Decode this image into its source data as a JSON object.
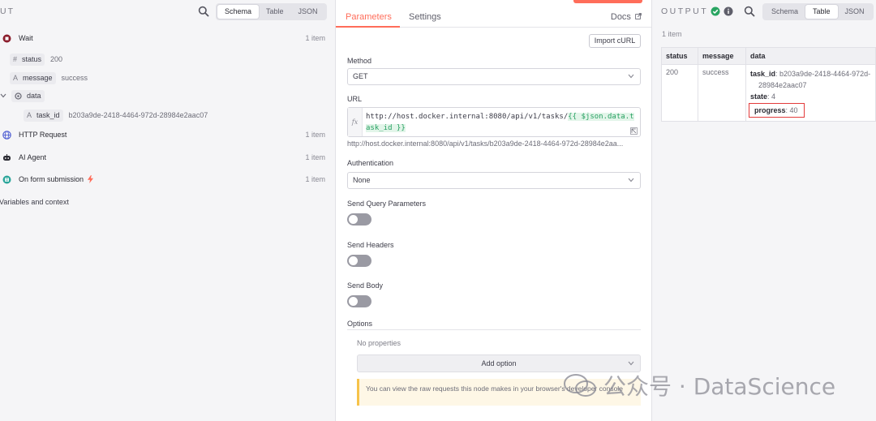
{
  "left_panel": {
    "title": "UT",
    "view_tabs": [
      "Schema",
      "Table",
      "JSON"
    ],
    "active_view": "Schema",
    "nodes": [
      {
        "name": "Wait",
        "count": "1 item",
        "icon": "wait-node-icon"
      },
      {
        "name": "HTTP Request",
        "count": "1 item",
        "icon": "globe-icon"
      },
      {
        "name": "AI Agent",
        "count": "1 item",
        "icon": "robot-icon"
      },
      {
        "name": "On form submission",
        "count": "1 item",
        "icon": "form-trigger-icon"
      }
    ],
    "fields": {
      "status": {
        "type": "#",
        "key": "status",
        "value": "200"
      },
      "message": {
        "type": "A",
        "key": "message",
        "value": "success"
      },
      "data": {
        "key": "data"
      },
      "task_id": {
        "type": "A",
        "key": "task_id",
        "value": "b203a9de-2418-4464-972d-28984e2aac07"
      }
    },
    "variables_label": "Variables and context"
  },
  "middle_panel": {
    "tabs": [
      "Parameters",
      "Settings"
    ],
    "active_tab": "Parameters",
    "docs_label": "Docs",
    "import_curl_label": "Import cURL",
    "method": {
      "label": "Method",
      "value": "GET"
    },
    "url": {
      "label": "URL",
      "expr_prefix": "http://host.docker.internal:8080/api/v1/tasks/",
      "expr_var": "{{ $json.data.task_id }}",
      "preview": "http://host.docker.internal:8080/api/v1/tasks/b203a9de-2418-4464-972d-28984e2aa..."
    },
    "authentication": {
      "label": "Authentication",
      "value": "None"
    },
    "send_query_label": "Send Query Parameters",
    "send_headers_label": "Send Headers",
    "send_body_label": "Send Body",
    "options_label": "Options",
    "no_properties": "No properties",
    "add_option_label": "Add option",
    "notice": "You can view the raw requests this node makes in your browser's developer console"
  },
  "right_panel": {
    "title": "OUTPUT",
    "view_tabs": [
      "Schema",
      "Table",
      "JSON"
    ],
    "active_view": "Table",
    "item_count": "1 item",
    "columns": [
      "status",
      "message",
      "data"
    ],
    "row": {
      "status": "200",
      "message": "success",
      "data": {
        "task_id_key": "task_id",
        "task_id_val": ": b203a9de-2418-4464-972d-28984e2aac07",
        "state_key": "state",
        "state_val": ": 4",
        "progress_key": "progress",
        "progress_val": ": 40"
      }
    }
  },
  "watermark": "公众号 · DataScience"
}
